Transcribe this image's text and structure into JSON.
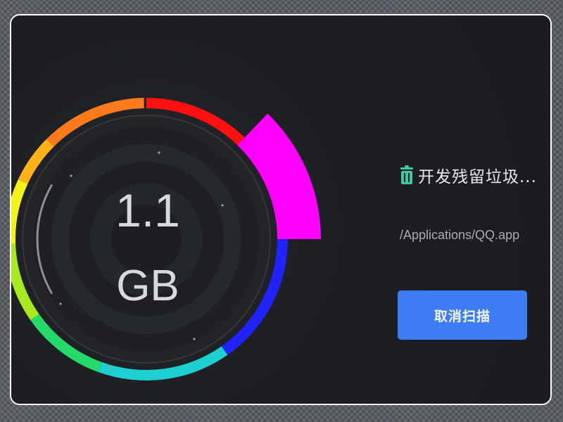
{
  "gauge": {
    "size_value": "1.1",
    "size_unit": "GB",
    "arc_colors": [
      "#ff7a1a",
      "#ff1010",
      "#ff00ff",
      "#2222ff",
      "#1ecfd0",
      "#26d96b",
      "#a8e820",
      "#f2f21a",
      "#ffb21a"
    ]
  },
  "scan": {
    "status_icon": "trash-icon",
    "status_text": "开发残留垃圾...",
    "current_path": "/Applications/QQ.app"
  },
  "actions": {
    "cancel_label": "取消扫描"
  },
  "colors": {
    "window_background": "#1b1d21",
    "accent_button": "#3d7cf3",
    "trash_icon": "#3ec8a8"
  }
}
